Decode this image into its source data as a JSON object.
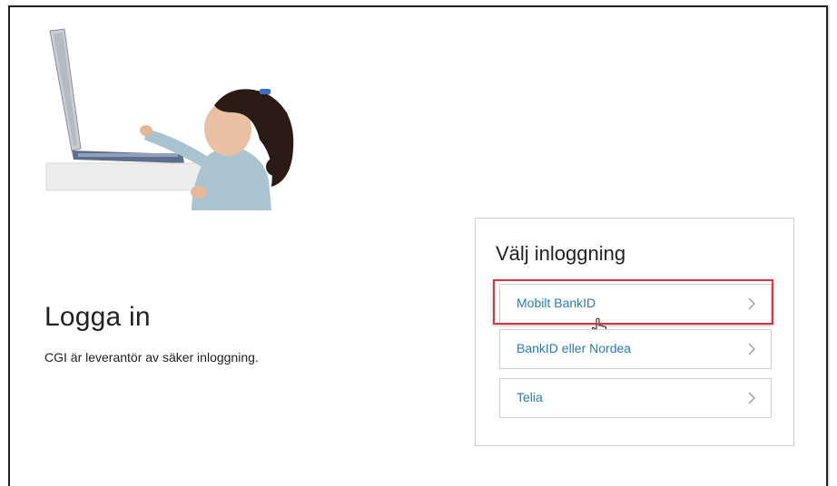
{
  "page": {
    "title": "Logga in",
    "subtitle": "CGI är leverantör av säker inloggning."
  },
  "login": {
    "heading": "Välj inloggning",
    "options": [
      {
        "label": "Mobilt BankID",
        "selected": true
      },
      {
        "label": "BankID eller Nordea",
        "selected": false
      },
      {
        "label": "Telia",
        "selected": false
      }
    ]
  },
  "colors": {
    "link": "#2b7bb0",
    "highlight": "#d9363e",
    "border": "#cfcfcf"
  }
}
